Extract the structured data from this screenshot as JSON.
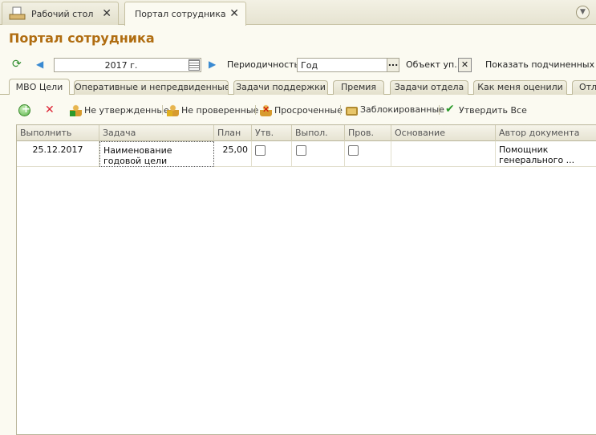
{
  "window_tabs": [
    {
      "label": "Рабочий стол",
      "active": false
    },
    {
      "label": "Портал сотрудника",
      "active": true
    }
  ],
  "page_title": "Портал сотрудника",
  "filter_bar": {
    "period_value": "2017 г.",
    "periodicity_label": "Периодичность:",
    "periodicity_value": "Год",
    "object_label": "Объект уп...",
    "show_subordinates_label": "Показать подчиненных"
  },
  "content_tabs": [
    {
      "label": "МВО Цели",
      "active": true
    },
    {
      "label": "Оперативные и непредвиденные"
    },
    {
      "label": "Задачи поддержки"
    },
    {
      "label": "Премия"
    },
    {
      "label": "Задачи отдела"
    },
    {
      "label": "Как меня оценили"
    },
    {
      "label": "Отл"
    }
  ],
  "actions": {
    "not_approved": "Не утвержденные",
    "not_checked": "Не проверенные",
    "overdue": "Просроченные",
    "locked": "Заблокированные",
    "approve_all": "Утвердить Все"
  },
  "table": {
    "columns": [
      "Выполнить",
      "Задача",
      "План",
      "Утв.",
      "Выпол.",
      "Пров.",
      "Основание",
      "Автор документа"
    ],
    "rows": [
      {
        "due": "25.12.2017",
        "task": "Наименование годовой цели",
        "plan": "25,00",
        "approved": false,
        "done": false,
        "checked": false,
        "basis": "",
        "author": "Помощник генерального ..."
      }
    ]
  },
  "icons": [
    "document-icon",
    "close-icon",
    "dropdown-icon",
    "refresh-icon",
    "arrow-left-icon",
    "calendar-icon",
    "arrow-right-icon",
    "add-icon",
    "delete-icon",
    "user-green-icon",
    "user-yellow-icon",
    "user-red-icon",
    "lock-icon",
    "check-icon",
    "mouse-cursor-icon"
  ],
  "colors": {
    "title": "#b06d11",
    "background": "#fbfaf1"
  }
}
